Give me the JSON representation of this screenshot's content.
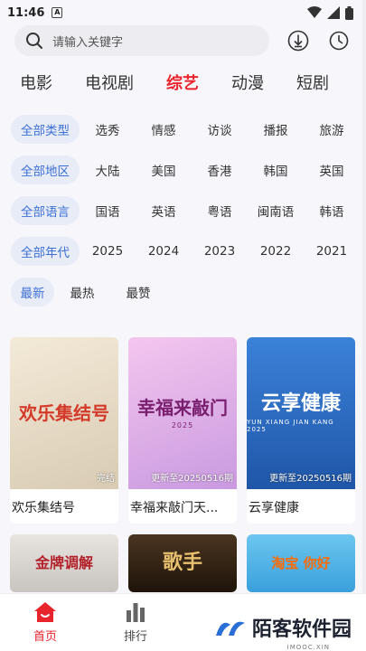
{
  "status": {
    "time": "11:46",
    "app_icon_letter": "A",
    "icons": [
      "wifi-icon",
      "signal-icon",
      "battery-icon"
    ]
  },
  "search": {
    "placeholder": "请输入关键字",
    "icons": [
      "search-icon",
      "download-icon",
      "history-icon"
    ]
  },
  "category_tabs": [
    {
      "label": "电影",
      "active": false
    },
    {
      "label": "电视剧",
      "active": false
    },
    {
      "label": "综艺",
      "active": true
    },
    {
      "label": "动漫",
      "active": false
    },
    {
      "label": "短剧",
      "active": false
    }
  ],
  "filters": {
    "type": {
      "selected": "全部类型",
      "options": [
        "选秀",
        "情感",
        "访谈",
        "播报",
        "旅游"
      ]
    },
    "region": {
      "selected": "全部地区",
      "options": [
        "大陆",
        "美国",
        "香港",
        "韩国",
        "英国"
      ]
    },
    "language": {
      "selected": "全部语言",
      "options": [
        "国语",
        "英语",
        "粤语",
        "闽南语",
        "韩语"
      ]
    },
    "year": {
      "selected": "全部年代",
      "options": [
        "2025",
        "2024",
        "2023",
        "2022",
        "2021"
      ]
    },
    "sort": {
      "selected": "最新",
      "options": [
        "最热",
        "最赞"
      ]
    }
  },
  "cards": [
    {
      "name": "欢乐集结号",
      "badge": "完结",
      "poster_title": "欢乐集结号",
      "poster_sub": "",
      "bg": "#e9e2d6",
      "fg": "#d43a2a"
    },
    {
      "name": "幸福来敲门天...",
      "badge": "更新至20250516期",
      "poster_title": "幸福来敲门",
      "poster_sub": "2025",
      "bg": "#e4b5e6",
      "fg": "#7a1e6e"
    },
    {
      "name": "云享健康",
      "badge": "更新至20250516期",
      "poster_title": "云享健康",
      "poster_sub": "YUN XIANG JIAN KANG 2025",
      "bg": "#2f6fcb",
      "fg": "#ffffff"
    },
    {
      "name": "",
      "badge": "",
      "poster_title": "金牌调解",
      "poster_sub": "",
      "bg": "#d9d6d2",
      "fg": "#b3202a"
    },
    {
      "name": "",
      "badge": "",
      "poster_title": "歌手",
      "poster_sub": "",
      "bg": "#3a2a1a",
      "fg": "#e8c070"
    },
    {
      "name": "",
      "badge": "",
      "poster_title": "淘宝 你好",
      "poster_sub": "",
      "bg": "#56b7e8",
      "fg": "#ff6a00"
    }
  ],
  "bottom_nav": [
    {
      "label": "首页",
      "icon": "home-icon",
      "active": true
    },
    {
      "label": "排行",
      "icon": "ranking-icon",
      "active": false
    }
  ],
  "watermark": {
    "text": "陌客软件园",
    "sub": "IMOOC.XIN"
  },
  "colors": {
    "accent": "#e8242c",
    "chip_bg": "#e8ecf7",
    "chip_fg": "#3d6fd6"
  }
}
